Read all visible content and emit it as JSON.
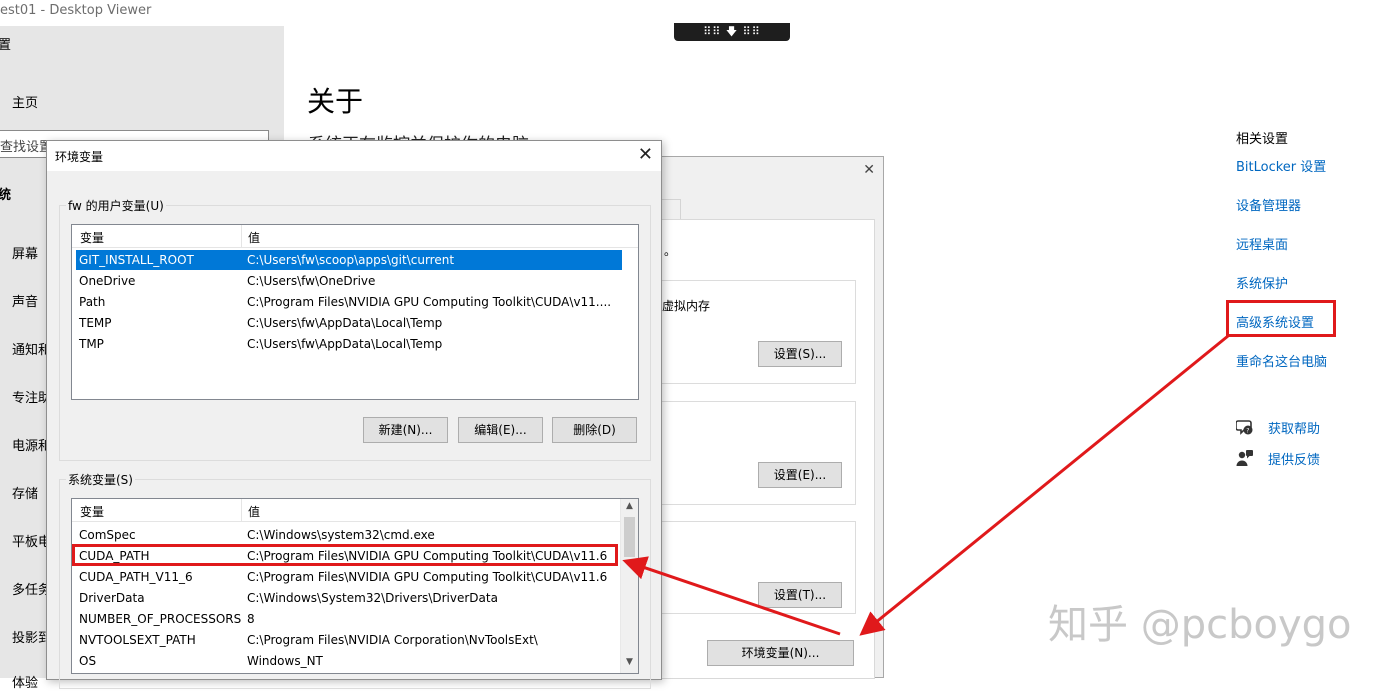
{
  "window": {
    "title": "est01 - Desktop Viewer",
    "toolbar_glyphs": "⠿⠿ 🡇 ⠿⠿"
  },
  "settings_nav": {
    "top_glyph": "置",
    "home": "主页",
    "search_text": "查找设置",
    "section": "统",
    "items": [
      "屏幕",
      "声音",
      "通知和",
      "专注助",
      "电源和",
      "存储",
      "平板电",
      "多任务",
      "投影到",
      "体验"
    ]
  },
  "about": {
    "title": "关于",
    "subtitle": "系统正在监控并保护你的电脑"
  },
  "related": {
    "header": "相关设置",
    "links": [
      "BitLocker 设置",
      "设备管理器",
      "远程桌面",
      "系统保护",
      "高级系统设置",
      "重命名这台电脑"
    ],
    "help": [
      "获取帮助",
      "提供反馈"
    ]
  },
  "sysprop": {
    "close": "✕",
    "text_dot": "。",
    "text_vm": "虚拟内存",
    "buttons": [
      "设置(S)...",
      "设置(E)...",
      "设置(T)...",
      "环境变量(N)..."
    ]
  },
  "env_dialog": {
    "title": "环境变量",
    "close": "✕",
    "user_group_label": "fw 的用户变量(U)",
    "col_var": "变量",
    "col_val": "值",
    "user_vars": [
      {
        "name": "GIT_INSTALL_ROOT",
        "value": "C:\\Users\\fw\\scoop\\apps\\git\\current"
      },
      {
        "name": "OneDrive",
        "value": "C:\\Users\\fw\\OneDrive"
      },
      {
        "name": "Path",
        "value": "C:\\Program Files\\NVIDIA GPU Computing Toolkit\\CUDA\\v11...."
      },
      {
        "name": "TEMP",
        "value": "C:\\Users\\fw\\AppData\\Local\\Temp"
      },
      {
        "name": "TMP",
        "value": "C:\\Users\\fw\\AppData\\Local\\Temp"
      }
    ],
    "user_buttons": {
      "new": "新建(N)...",
      "edit": "编辑(E)...",
      "delete": "删除(D)"
    },
    "sys_group_label": "系统变量(S)",
    "sys_vars": [
      {
        "name": "ComSpec",
        "value": "C:\\Windows\\system32\\cmd.exe"
      },
      {
        "name": "CUDA_PATH",
        "value": "C:\\Program Files\\NVIDIA GPU Computing Toolkit\\CUDA\\v11.6"
      },
      {
        "name": "CUDA_PATH_V11_6",
        "value": "C:\\Program Files\\NVIDIA GPU Computing Toolkit\\CUDA\\v11.6"
      },
      {
        "name": "DriverData",
        "value": "C:\\Windows\\System32\\Drivers\\DriverData"
      },
      {
        "name": "NUMBER_OF_PROCESSORS",
        "value": "8"
      },
      {
        "name": "NVTOOLSEXT_PATH",
        "value": "C:\\Program Files\\NVIDIA Corporation\\NvToolsExt\\"
      },
      {
        "name": "OS",
        "value": "Windows_NT"
      }
    ]
  },
  "watermark": "知乎 @pcboygo",
  "colors": {
    "accent_link": "#0067c0",
    "highlight_red": "#e0191b",
    "selection": "#0078d7"
  }
}
